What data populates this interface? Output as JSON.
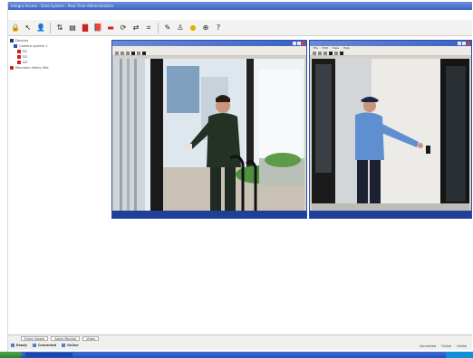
{
  "window": {
    "title": "Integra Access · Data System - Real Time Administration"
  },
  "toolbar": {
    "icons": [
      "lock-icon",
      "pointer-icon",
      "user-icon",
      "sort-icon",
      "cards-icon",
      "door-icon",
      "book-icon",
      "alarm-icon",
      "refresh-icon",
      "transfer-icon",
      "filter-icon",
      "tool-icon",
      "person-icon",
      "bell-icon",
      "zoom-icon",
      "help-icon"
    ]
  },
  "tree": {
    "items": [
      {
        "label": "Devices",
        "level": 0,
        "icon": "root"
      },
      {
        "label": "Camera system 1",
        "level": 1,
        "icon": "cam"
      },
      {
        "label": "D1",
        "level": 2,
        "icon": "door"
      },
      {
        "label": "D2",
        "level": 2,
        "icon": "door"
      },
      {
        "label": "D3",
        "level": 2,
        "icon": "door"
      },
      {
        "label": "Mountain Valley Site",
        "level": 0,
        "icon": "site"
      }
    ]
  },
  "video_left": {
    "title": "",
    "menu": []
  },
  "video_right": {
    "title": "",
    "menu": [
      "File",
      "Edit",
      "View",
      "Help"
    ]
  },
  "statusbar": {
    "tabs": [
      "Event Viewer",
      "Alarm Monitor",
      "Video"
    ],
    "items": [
      "Ready",
      "Connected",
      "Online"
    ],
    "right": [
      "Connected",
      "Online",
      "Online"
    ]
  }
}
